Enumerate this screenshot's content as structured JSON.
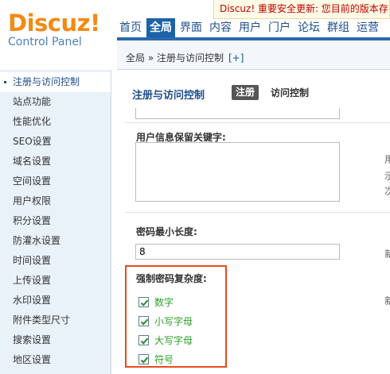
{
  "logo": {
    "title": "Discuz!",
    "subtitle": "Control Panel"
  },
  "notice": "Discuz! 重要安全更新: 您目前的版本存",
  "nav": [
    "首页",
    "全局",
    "界面",
    "内容",
    "用户",
    "门户",
    "论坛",
    "群组",
    "运营"
  ],
  "nav_active": "全局",
  "breadcrumb": {
    "text": "全局 » 注册与访问控制",
    "plus": "[+]"
  },
  "sidebar": {
    "items": [
      "注册与访问控制",
      "站点功能",
      "性能优化",
      "SEO设置",
      "域名设置",
      "空间设置",
      "用户权限",
      "积分设置",
      "防灌水设置",
      "时间设置",
      "上传设置",
      "水印设置",
      "附件类型尺寸",
      "搜索设置",
      "地区设置"
    ],
    "active": "注册与访问控制"
  },
  "main": {
    "title": "注册与访问控制",
    "tab_active": "注册",
    "tab_link": "访问控制",
    "keyword_label": "用户信息保留关键字:",
    "keyword_value": "",
    "keyword_hints": [
      "用",
      "示",
      "次"
    ],
    "minlen_label": "密码最小长度:",
    "minlen_value": "8",
    "minlen_hint": "新",
    "complexity_label": "强制密码复杂度:",
    "complexity_hint": "新",
    "complexity_options": [
      {
        "label": "数字",
        "checked": true
      },
      {
        "label": "小写字母",
        "checked": true
      },
      {
        "label": "大写字母",
        "checked": true
      },
      {
        "label": "符号",
        "checked": true
      }
    ]
  },
  "colors": {
    "accent": "#1b62a8",
    "logo": "#f28a14",
    "highlight": "#e84b1b",
    "check_label": "#2aa02a"
  }
}
